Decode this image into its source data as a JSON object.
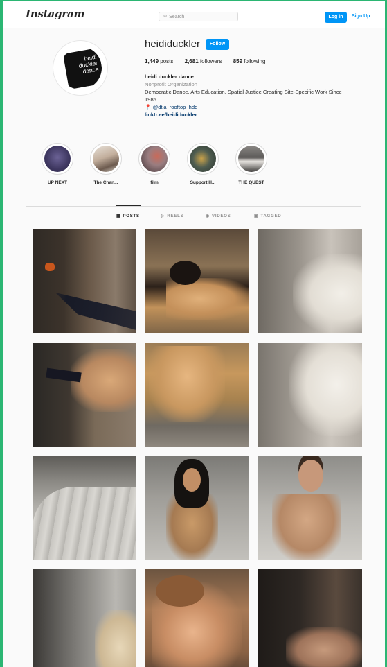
{
  "nav": {
    "logo": "Instagram",
    "search_placeholder": "Search",
    "login_label": "Log in",
    "signup_label": "Sign Up"
  },
  "profile": {
    "avatar_text": "heidi duckler dance",
    "username": "heididuckler",
    "follow_label": "Follow",
    "posts_count": "1,449",
    "posts_label": "posts",
    "followers_count": "2,681",
    "followers_label": "followers",
    "following_count": "859",
    "following_label": "following",
    "full_name": "heidi duckler dance",
    "category": "Nonprofit Organization",
    "bio_line1": "Democratic Dance, Arts Education, Spatial Justice Creating Site-Specific Work Since",
    "bio_line2": "1985",
    "location_mention": "@dtla_rooftop_hdd",
    "link": "linktr.ee/heididuckler"
  },
  "highlights": [
    {
      "label": "UP NEXT",
      "color": "#4b4470"
    },
    {
      "label": "The Chan...",
      "color": "#b9a79b"
    },
    {
      "label": "film",
      "color": "#a0868a"
    },
    {
      "label": "Support H...",
      "color": "#3e4a42"
    },
    {
      "label": "THE QUEST",
      "color": "#6f6d6a"
    }
  ],
  "tabs": [
    {
      "label": "POSTS",
      "icon": "grid-icon"
    },
    {
      "label": "REELS",
      "icon": "reels-icon"
    },
    {
      "label": "VIDEOS",
      "icon": "video-icon"
    },
    {
      "label": "TAGGED",
      "icon": "tagged-icon"
    }
  ],
  "grid_colors": {
    "post_1": "#4a3c32",
    "post_2": "#6b5540",
    "post_3": "#b6ada3",
    "post_4": "#5d4637",
    "post_5": "#a88a5e",
    "post_6": "#b9b3ab",
    "post_7": "#8b8983",
    "post_8": "#8f8d86",
    "post_9": "#9c9891",
    "post_10": "#8d8b86",
    "post_11": "#a77955",
    "post_12": "#3d3733"
  }
}
